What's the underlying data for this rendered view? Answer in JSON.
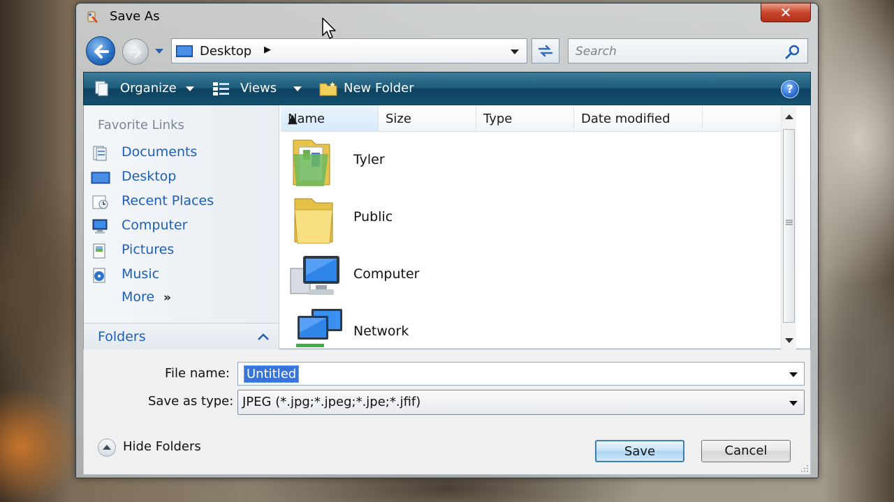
{
  "window": {
    "title": "Save As",
    "close_label": "✕"
  },
  "address": {
    "location": "Desktop",
    "separator": "▶"
  },
  "search": {
    "placeholder": "Search"
  },
  "toolbar": {
    "organize_label": "Organize",
    "views_label": "Views",
    "new_folder_label": "New Folder",
    "help_label": "?"
  },
  "nav_pane": {
    "favorites_title": "Favorite Links",
    "links": [
      {
        "label": "Documents",
        "icon": "documents-icon"
      },
      {
        "label": "Desktop",
        "icon": "desktop-icon"
      },
      {
        "label": "Recent Places",
        "icon": "recent-places-icon"
      },
      {
        "label": "Computer",
        "icon": "computer-icon"
      },
      {
        "label": "Pictures",
        "icon": "pictures-icon"
      },
      {
        "label": "Music",
        "icon": "music-icon"
      }
    ],
    "more_label": "More",
    "more_chevron": "»",
    "folders_label": "Folders"
  },
  "file_list": {
    "columns": [
      "Name",
      "Size",
      "Type",
      "Date modified"
    ],
    "sorted_column": "Name",
    "items": [
      {
        "name": "Tyler",
        "icon": "user-folder-icon"
      },
      {
        "name": "Public",
        "icon": "folder-icon"
      },
      {
        "name": "Computer",
        "icon": "computer-icon"
      },
      {
        "name": "Network",
        "icon": "network-icon"
      }
    ]
  },
  "form": {
    "file_name_label": "File name:",
    "file_name_value": "Untitled",
    "save_type_label": "Save as type:",
    "save_type_value": "JPEG (*.jpg;*.jpeg;*.jpe;*.jfif)"
  },
  "footer": {
    "hide_folders_label": "Hide Folders",
    "save_label": "Save",
    "cancel_label": "Cancel"
  },
  "colors": {
    "toolbar": "#1b5a78",
    "link": "#1e5fb4",
    "selection": "#3874d8",
    "close": "#c9452c"
  }
}
